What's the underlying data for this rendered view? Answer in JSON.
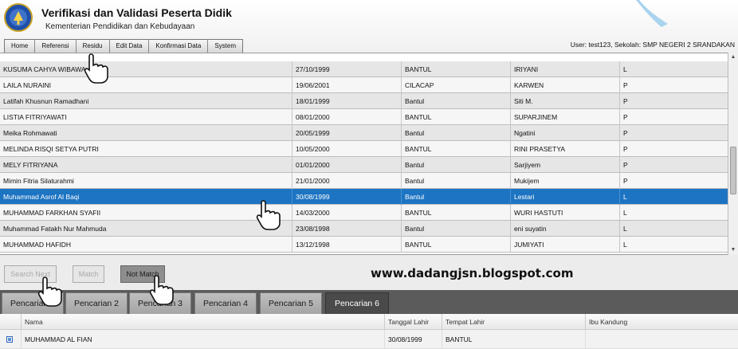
{
  "header": {
    "title": "Verifikasi dan Validasi Peserta Didik",
    "subtitle": "Kementerian Pendidikan dan Kebudayaan",
    "user_info": "User: test123, Sekolah: SMP NEGERI 2 SRANDAKAN"
  },
  "menu": {
    "items": [
      "Home",
      "Referensi",
      "Residu",
      "Edit Data",
      "Konfirmasi Data",
      "System"
    ]
  },
  "top_table": {
    "rows": [
      {
        "nama": "KUSUMA CAHYA WIBAWA",
        "tgl": "27/10/1999",
        "tempat": "BANTUL",
        "ibu": "IRIYANI",
        "jk": "L"
      },
      {
        "nama": "LAILA NURAINI",
        "tgl": "19/06/2001",
        "tempat": "CILACAP",
        "ibu": "KARWEN",
        "jk": "P"
      },
      {
        "nama": "Latifah Khusnun Ramadhani",
        "tgl": "18/01/1999",
        "tempat": "Bantul",
        "ibu": "Siti M.",
        "jk": "P"
      },
      {
        "nama": "LISTIA FITRIYAWATI",
        "tgl": "08/01/2000",
        "tempat": "BANTUL",
        "ibu": "SUPARJINEM",
        "jk": "P"
      },
      {
        "nama": "Meika Rohmawati",
        "tgl": "20/05/1999",
        "tempat": "Bantul",
        "ibu": "Ngatini",
        "jk": "P"
      },
      {
        "nama": "MELINDA RISQI SETYA PUTRI",
        "tgl": "10/05/2000",
        "tempat": "BANTUL",
        "ibu": "RINI PRASETYA",
        "jk": "P"
      },
      {
        "nama": "MELY FITRIYANA",
        "tgl": "01/01/2000",
        "tempat": "Bantul",
        "ibu": "Sarjiyem",
        "jk": "P"
      },
      {
        "nama": "Mimin Fitria Silaturahmi",
        "tgl": "21/01/2000",
        "tempat": "Bantul",
        "ibu": "Mukijem",
        "jk": "P"
      },
      {
        "nama": "Muhammad Asrof Al Baqi",
        "tgl": "30/08/1999",
        "tempat": "Bantul",
        "ibu": "Lestari",
        "jk": "L"
      },
      {
        "nama": "MUHAMMAD FARKHAN SYAFII",
        "tgl": "14/03/2000",
        "tempat": "BANTUL",
        "ibu": "WURI HASTUTI",
        "jk": "L"
      },
      {
        "nama": "Muhammad Fatakh Nur Mahmuda",
        "tgl": "23/08/1998",
        "tempat": "Bantul",
        "ibu": "eni suyatin",
        "jk": "L"
      },
      {
        "nama": "MUHAMMAD HAFIDH",
        "tgl": "13/12/1998",
        "tempat": "BANTUL",
        "ibu": "JUMIYATI",
        "jk": "L"
      }
    ],
    "selected_index": 8
  },
  "buttons": {
    "search_next": "Search Next",
    "match": "Match",
    "not_match": "Not Match"
  },
  "watermark": "www.dadangjsn.blogspot.com",
  "tabs": [
    {
      "label": "Pencarian 1"
    },
    {
      "label": "Pencarian 2"
    },
    {
      "label": "Pencarian 3"
    },
    {
      "label": "Pencarian 4"
    },
    {
      "label": "Pencarian 5"
    },
    {
      "label": "Pencarian 6"
    }
  ],
  "bottom_table": {
    "headers": {
      "nama": "Nama",
      "tgl": "Tanggal Lahir",
      "tempat": "Tempat Lahir",
      "ibu": "Ibu Kandung"
    },
    "rows": [
      {
        "nama": "MUHAMMAD AL FIAN",
        "tgl": "30/08/1999",
        "tempat": "BANTUL",
        "ibu": ""
      }
    ]
  },
  "colors": {
    "selected_row": "#1d74c2",
    "tab_bar": "#5b5b5b",
    "active_tab": "#4a4a4a"
  }
}
